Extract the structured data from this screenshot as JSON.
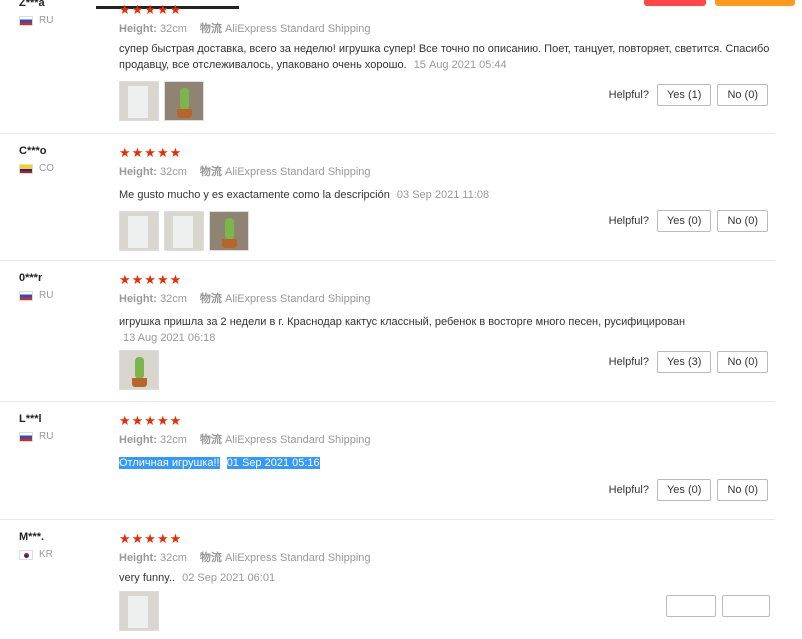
{
  "reviews": [
    {
      "user": "Z***a",
      "country": "RU",
      "flag": "ru",
      "stars": "★★★★★",
      "height_label": "Height:",
      "height": "32cm",
      "shipping_label": "物流",
      "shipping": "AliExpress Standard Shipping",
      "text": "супер быстрая доставка, всего за неделю! игрушка супер! Все точно по описанию. Поет, танцует, повторяет, светится. Спасибо продавцу, все отслеживалось, упаковано очень хорошо.",
      "date": "15 Aug 2021 05:44",
      "helpful_label": "Helpful?",
      "yes": "Yes (1)",
      "no": "No (0)"
    },
    {
      "user": "C***o",
      "country": "CO",
      "flag": "co",
      "stars": "★★★★★",
      "height_label": "Height:",
      "height": "32cm",
      "shipping_label": "物流",
      "shipping": "AliExpress Standard Shipping",
      "text": "Me gusto mucho y es exactamente como la descripción",
      "date": "03 Sep 2021 11:08",
      "helpful_label": "Helpful?",
      "yes": "Yes (0)",
      "no": "No (0)"
    },
    {
      "user": "0***r",
      "country": "RU",
      "flag": "ru",
      "stars": "★★★★★",
      "height_label": "Height:",
      "height": "32cm",
      "shipping_label": "物流",
      "shipping": "AliExpress Standard Shipping",
      "text": "игрушка пришла за 2 недели в г. Краснодар кактус классный, ребенок в восторге много песен, русифицирован",
      "date": "13 Aug 2021 06:18",
      "helpful_label": "Helpful?",
      "yes": "Yes (3)",
      "no": "No (0)"
    },
    {
      "user": "L***l",
      "country": "RU",
      "flag": "ru",
      "stars": "★★★★★",
      "height_label": "Height:",
      "height": "32cm",
      "shipping_label": "物流",
      "shipping": "AliExpress Standard Shipping",
      "text": "Отличная игрушка!!",
      "date": "01 Sep 2021 05:16",
      "helpful_label": "Helpful?",
      "yes": "Yes (0)",
      "no": "No (0)"
    },
    {
      "user": "M***.",
      "country": "KR",
      "flag": "kr",
      "stars": "★★★★★",
      "height_label": "Height:",
      "height": "32cm",
      "shipping_label": "物流",
      "shipping": "AliExpress Standard Shipping",
      "text": "very funny..",
      "date": "02 Sep 2021 06:01"
    }
  ]
}
